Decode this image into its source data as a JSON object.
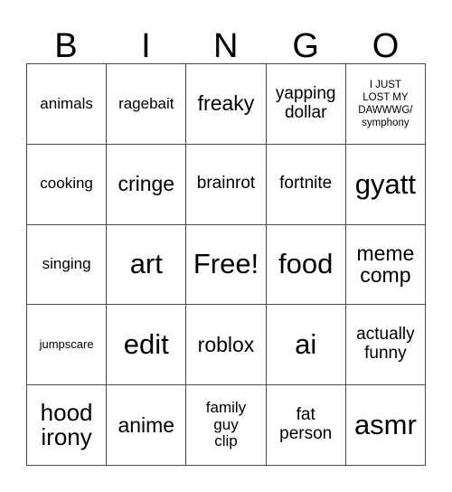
{
  "card": {
    "title": "BINGO",
    "header_letters": [
      "B",
      "I",
      "N",
      "G",
      "O"
    ],
    "columns": 5,
    "rows": 5,
    "free_space_label": "Free!",
    "free_space_position": "row3-col3",
    "colors": {
      "background": "#ffffff",
      "text": "#000000",
      "grid_line": "#4a4a4a"
    },
    "cells": [
      {
        "id": "r1c1",
        "text": "animals",
        "size": "sm",
        "lines": 1
      },
      {
        "id": "r1c2",
        "text": "ragebait",
        "size": "sm",
        "lines": 1
      },
      {
        "id": "r1c3",
        "text": "freaky",
        "size": "lg",
        "lines": 1
      },
      {
        "id": "r1c4",
        "text": "yapping\ndollar",
        "size": "md",
        "lines": 2
      },
      {
        "id": "r1c5",
        "text": "I JUST\nLOST MY\nDAWWWG/\nsymphony",
        "size": "xxs",
        "lines": 4
      },
      {
        "id": "r2c1",
        "text": "cooking",
        "size": "sm",
        "lines": 1
      },
      {
        "id": "r2c2",
        "text": "cringe",
        "size": "lg",
        "lines": 1
      },
      {
        "id": "r2c3",
        "text": "brainrot",
        "size": "md",
        "lines": 1
      },
      {
        "id": "r2c4",
        "text": "fortnite",
        "size": "md",
        "lines": 1
      },
      {
        "id": "r2c5",
        "text": "gyatt",
        "size": "xxl",
        "lines": 1
      },
      {
        "id": "r3c1",
        "text": "singing",
        "size": "sm",
        "lines": 1
      },
      {
        "id": "r3c2",
        "text": "art",
        "size": "xxl",
        "lines": 1
      },
      {
        "id": "r3c3",
        "text": "Free!",
        "size": "xxl",
        "lines": 1
      },
      {
        "id": "r3c4",
        "text": "food",
        "size": "xxl",
        "lines": 1
      },
      {
        "id": "r3c5",
        "text": "meme\ncomp",
        "size": "lg",
        "lines": 2
      },
      {
        "id": "r4c1",
        "text": "jumpscare",
        "size": "xs",
        "lines": 1
      },
      {
        "id": "r4c2",
        "text": "edit",
        "size": "xxl",
        "lines": 1
      },
      {
        "id": "r4c3",
        "text": "roblox",
        "size": "lg",
        "lines": 1
      },
      {
        "id": "r4c4",
        "text": "ai",
        "size": "xxl",
        "lines": 1
      },
      {
        "id": "r4c5",
        "text": "actually\nfunny",
        "size": "md",
        "lines": 2
      },
      {
        "id": "r5c1",
        "text": "hood\nirony",
        "size": "xl",
        "lines": 2
      },
      {
        "id": "r5c2",
        "text": "anime",
        "size": "lg",
        "lines": 1
      },
      {
        "id": "r5c3",
        "text": "family\nguy\nclip",
        "size": "sm",
        "lines": 3
      },
      {
        "id": "r5c4",
        "text": "fat\nperson",
        "size": "md",
        "lines": 2
      },
      {
        "id": "r5c5",
        "text": "asmr",
        "size": "xxl",
        "lines": 1
      }
    ]
  }
}
